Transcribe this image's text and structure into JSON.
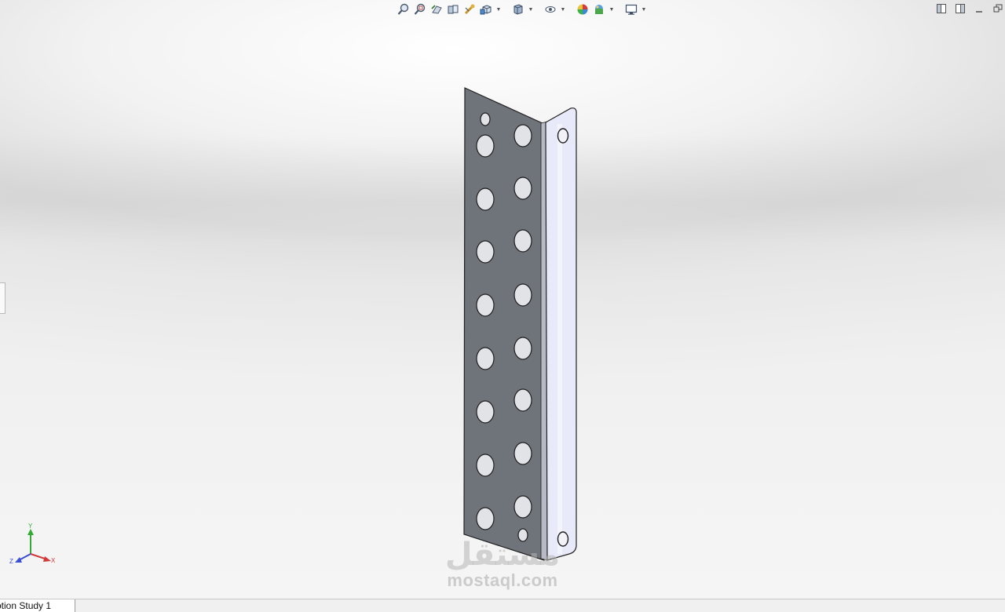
{
  "heads_up_toolbar": {
    "buttons": [
      {
        "icon": "zoom-to-fit-icon"
      },
      {
        "icon": "zoom-to-area-icon"
      },
      {
        "icon": "previous-view-icon"
      },
      {
        "icon": "section-view-icon"
      },
      {
        "icon": "dynamic-annotation-view-icon"
      },
      {
        "icon": "view-orientation-icon",
        "has_dropdown": true
      },
      {
        "icon": "display-style-icon",
        "has_dropdown": true
      },
      {
        "icon": "hide-show-items-icon",
        "has_dropdown": true
      },
      {
        "icon": "edit-appearance-icon"
      },
      {
        "icon": "apply-scene-icon",
        "has_dropdown": true
      },
      {
        "icon": "view-settings-icon",
        "has_dropdown": true
      }
    ]
  },
  "window_controls": [
    "tile-left-icon",
    "tile-right-icon",
    "minimize-icon",
    "restore-icon"
  ],
  "model": {
    "face_color": "#6f737a",
    "flange_color": "#e8eaf9",
    "edge_color": "#222222"
  },
  "triad": {
    "y_label": "Y",
    "x_label": "X",
    "z_label": "Z",
    "y_color": "#33aa33",
    "x_color": "#d23a3a",
    "z_color": "#3a4fd2"
  },
  "watermark": {
    "arabic": "مستقل",
    "latin": "mostaql.com"
  },
  "bottom_tabs": {
    "motion_study": "otion Study 1"
  }
}
